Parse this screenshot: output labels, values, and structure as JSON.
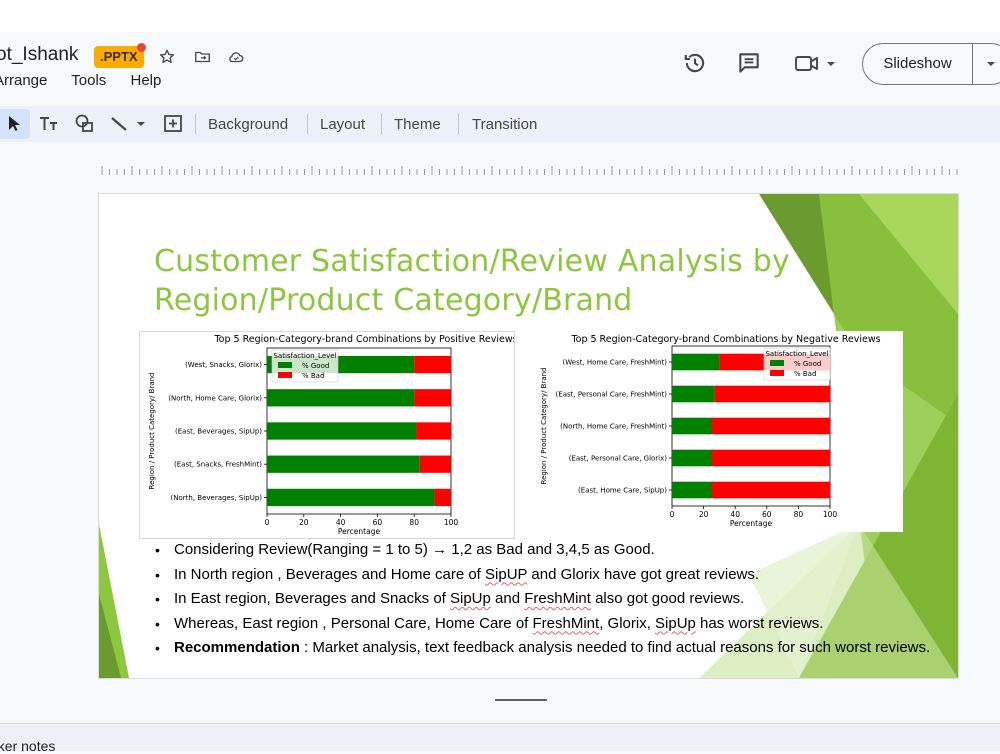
{
  "app": {
    "doc_title": "ot_Ishank",
    "file_badge": ".PPTX",
    "menu": [
      "Arrange",
      "Tools",
      "Help"
    ],
    "slideshow_label": "Slideshow",
    "toolbar": {
      "background_label": "Background",
      "layout_label": "Layout",
      "theme_label": "Theme",
      "transition_label": "Transition"
    },
    "speaker_notes_label": "aker notes",
    "colors": {
      "accent_green": "#8dc63f",
      "selected_tool": "#d3e3fd",
      "badge": "#f9ab00"
    }
  },
  "slide": {
    "title": "Customer Satisfaction/Review Analysis by Region/Product Category/Brand",
    "bullets": [
      {
        "id": "b1",
        "parts": [
          {
            "t": "Considering Review(Ranging = 1 to 5) → 1,2 as Bad and 3,4,5 as Good."
          }
        ]
      },
      {
        "id": "b2",
        "parts": [
          {
            "t": "In North region , Beverages and Home care of "
          },
          {
            "t": "SipUP",
            "sq": true
          },
          {
            "t": " and Glorix have got great reviews."
          }
        ]
      },
      {
        "id": "b3",
        "parts": [
          {
            "t": "In East region, Beverages and Snacks of "
          },
          {
            "t": "SipUp",
            "sq": true
          },
          {
            "t": " and "
          },
          {
            "t": "FreshMint",
            "sq": true
          },
          {
            "t": " also got good reviews."
          }
        ]
      },
      {
        "id": "b4",
        "parts": [
          {
            "t": "Whereas,  East region , Personal Care, Home Care of "
          },
          {
            "t": "FreshMint",
            "sq": true
          },
          {
            "t": ", Glorix, "
          },
          {
            "t": "SipUp",
            "sq": true
          },
          {
            "t": " has worst reviews."
          }
        ]
      },
      {
        "id": "b5",
        "parts": [
          {
            "t": "Recommendation",
            "b": true
          },
          {
            "t": " : Market analysis, text feedback analysis needed to find actual reasons for such worst reviews."
          }
        ]
      }
    ]
  },
  "chart_data": [
    {
      "type": "bar",
      "orientation": "horizontal",
      "stacked": true,
      "title": "Top 5 Region-Category-brand Combinations by Positive Reviews",
      "xlabel": "Percentage",
      "ylabel": "Region / Product Category/ Brand",
      "xlim": [
        0,
        100
      ],
      "xticks": [
        "0",
        "20",
        "40",
        "60",
        "80",
        "100"
      ],
      "legend_title": "Satisfaction_Level",
      "legend_position": "top-left",
      "categories": [
        "(West, Snacks, Glorix)",
        "(North, Home Care, Glorix)",
        "(East, Beverages, SipUp)",
        "(East, Snacks, FreshMint)",
        "(North, Beverages, SipUp)"
      ],
      "series": [
        {
          "name": "% Good",
          "color": "#008000",
          "values": [
            80,
            80,
            81,
            83,
            91
          ]
        },
        {
          "name": "% Bad",
          "color": "#ff0000",
          "values": [
            20,
            20,
            19,
            17,
            9
          ]
        }
      ]
    },
    {
      "type": "bar",
      "orientation": "horizontal",
      "stacked": true,
      "title": "Top 5 Region-Category-brand Combinations by Negative Reviews",
      "xlabel": "Percentage",
      "ylabel": "Region / Product Category/ Brand",
      "xlim": [
        0,
        100
      ],
      "xticks": [
        "0",
        "20",
        "40",
        "60",
        "80",
        "100"
      ],
      "legend_title": "Satisfaction_Level",
      "legend_position": "top-right",
      "categories": [
        "(West, Home Care, FreshMint)",
        "(East, Personal Care, FreshMint)",
        "(North, Home Care, FreshMint)",
        "(East, Personal Care, Glorix)",
        "(East, Home Care, SipUp)"
      ],
      "series": [
        {
          "name": "% Good",
          "color": "#008000",
          "values": [
            30,
            27,
            25,
            25,
            25
          ]
        },
        {
          "name": "% Bad",
          "color": "#ff0000",
          "values": [
            70,
            73,
            75,
            75,
            75
          ]
        }
      ]
    }
  ]
}
